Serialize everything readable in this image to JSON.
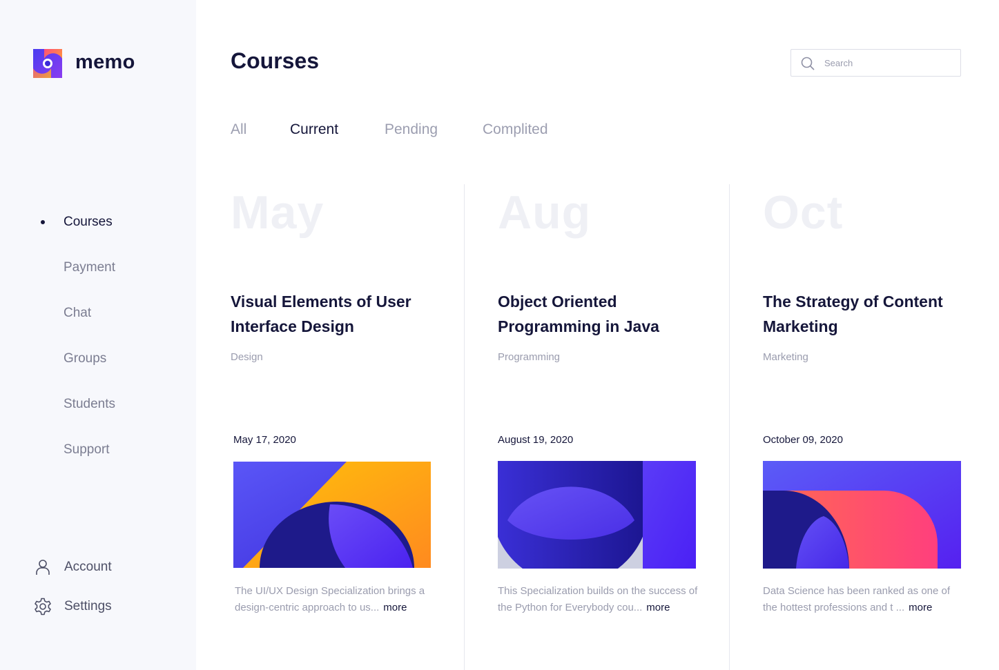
{
  "app": {
    "brand": "memo"
  },
  "sidebar": {
    "items": [
      {
        "label": "Courses",
        "active": true
      },
      {
        "label": "Payment",
        "active": false
      },
      {
        "label": "Chat",
        "active": false
      },
      {
        "label": "Groups",
        "active": false
      },
      {
        "label": "Students",
        "active": false
      },
      {
        "label": "Support",
        "active": false
      }
    ],
    "bottom": [
      {
        "label": "Account",
        "icon": "user-icon"
      },
      {
        "label": "Settings",
        "icon": "gear-icon"
      }
    ]
  },
  "header": {
    "title": "Courses",
    "search": {
      "placeholder": "Search",
      "value": ""
    }
  },
  "tabs": [
    {
      "label": "All",
      "active": false
    },
    {
      "label": "Current",
      "active": true
    },
    {
      "label": "Pending",
      "active": false
    },
    {
      "label": "Complited",
      "active": false
    }
  ],
  "courses": [
    {
      "month": "May",
      "title": "Visual Elements of User Interface Design",
      "category": "Design",
      "date": "May 17, 2020",
      "description": "The UI/UX Design Specialization brings a design-centric approach to us...",
      "more": "more"
    },
    {
      "month": "Aug",
      "title": "Object Oriented Programming in Java",
      "category": "Programming",
      "date": "August 19, 2020",
      "description": "This Specialization builds on the success of the Python for Everybody cou...",
      "more": "more"
    },
    {
      "month": "Oct",
      "title": "The Strategy of Content Marketing",
      "category": "Marketing",
      "date": "October 09, 2020",
      "description": "Data Science has been ranked as one of the hottest professions and t ...",
      "more": "more"
    }
  ],
  "colors": {
    "primary": "#15163a",
    "muted": "#9a9cae",
    "sidebar_bg": "#f7f8fc",
    "accent_violet": "#5b3cf5",
    "accent_orange": "#ff8a1f",
    "accent_pink": "#ff4f7b"
  }
}
